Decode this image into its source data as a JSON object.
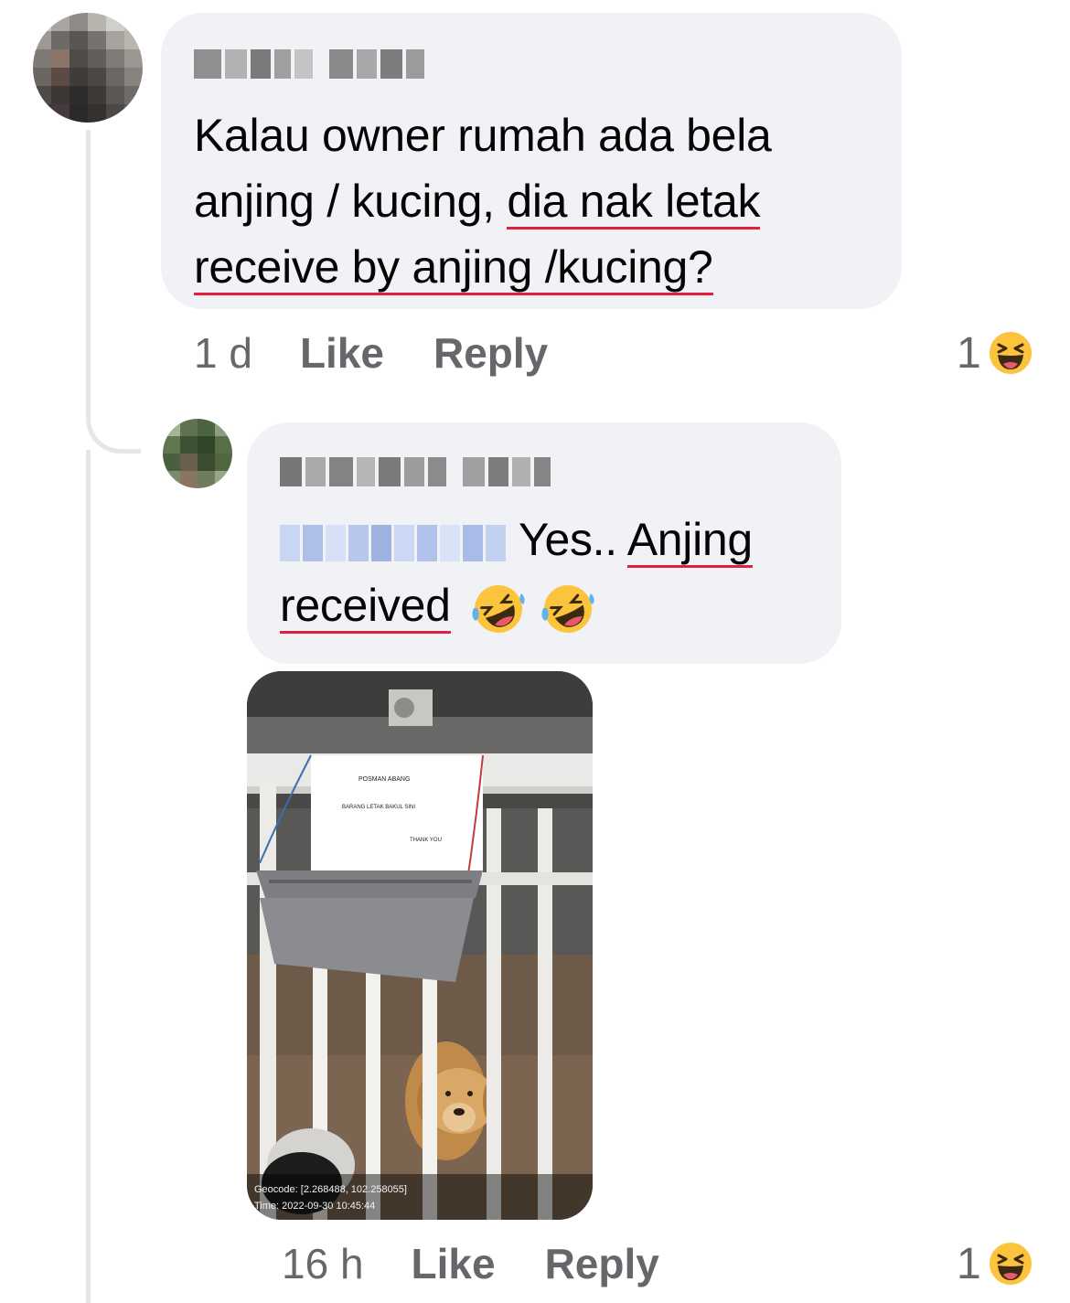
{
  "comments": [
    {
      "author": "Daryl Soh",
      "text_plain": "Kalau owner rumah ada bela anjing / kucing,",
      "text_underlined_1": "dia nak letak",
      "text_underlined_2": "receive by anjing /kucing?",
      "time": "1 d",
      "like_label": "Like",
      "reply_label": "Reply",
      "reaction_count": "1",
      "reaction_icon": "laughing-emoji-icon"
    },
    {
      "author": "Kimberly Wong",
      "mention": "Daryl Soh",
      "text_plain": "Yes..",
      "text_underlined_1": "Anjing",
      "text_underlined_2": "received",
      "emojis": [
        "rofl-emoji-icon",
        "rofl-emoji-icon"
      ],
      "photo": {
        "sign_line_1": "POSMAN ABANG",
        "sign_line_2": "BARANG LETAK BAKUL SINI",
        "sign_line_3": "THANK YOU",
        "geocode": "Geocode: [2.268488, 102.258055]",
        "time": "Time: 2022-09-30 10:45:44"
      },
      "time": "16 h",
      "like_label": "Like",
      "reply_label": "Reply",
      "reaction_count": "1",
      "reaction_icon": "laughing-emoji-icon"
    }
  ],
  "colors": {
    "bubble": "#f0f2f5",
    "meta_text": "#65676b",
    "spellcheck_underline": "#e41e3f",
    "mention_blue": "#c5d5f5"
  }
}
